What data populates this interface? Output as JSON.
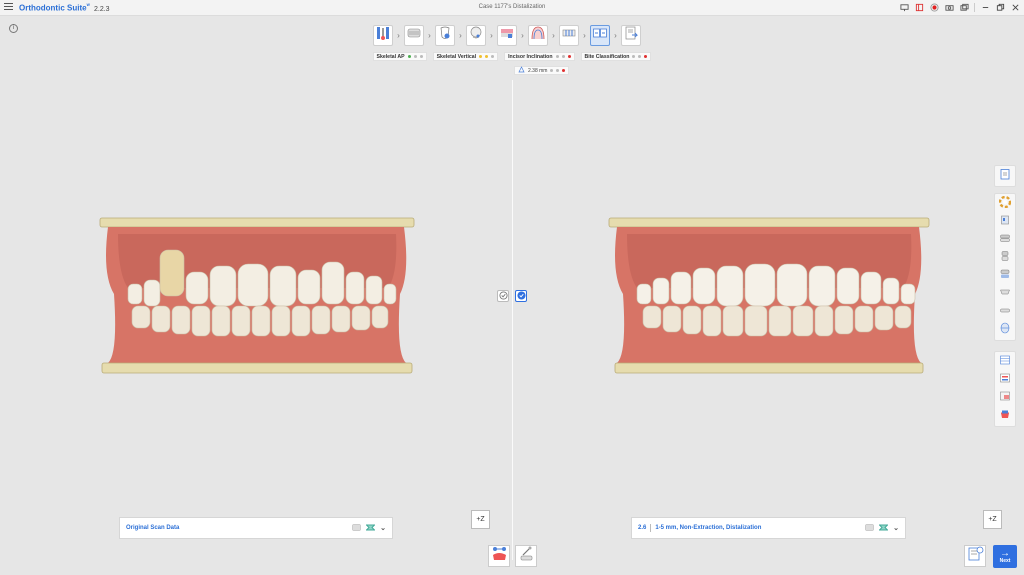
{
  "titlebar": {
    "app_name": "Orthodontic Suite",
    "app_sup": "ᵂ",
    "version": "2.2.3",
    "case_title": "Case 1177's Distalization"
  },
  "steps": [
    {
      "name": "step-model-setup",
      "icon": "tooth-tools-icon"
    },
    {
      "name": "step-trim",
      "icon": "arch-trim-icon"
    },
    {
      "name": "step-tooth-segment",
      "icon": "tooth-segment-icon"
    },
    {
      "name": "step-ceph",
      "icon": "ceph-head-icon"
    },
    {
      "name": "step-occlusion",
      "icon": "occlusion-icon"
    },
    {
      "name": "step-arch-form",
      "icon": "arch-form-icon"
    },
    {
      "name": "step-ipr",
      "icon": "ipr-icon"
    },
    {
      "name": "step-simulation",
      "icon": "compare-icon",
      "active": true
    },
    {
      "name": "step-report",
      "icon": "report-export-icon"
    }
  ],
  "analysis": [
    {
      "label": "Skeletal AP",
      "dots": [
        "#4caf50",
        "#bbbbbb",
        "#bbbbbb"
      ]
    },
    {
      "label": "Skeletal Vertical",
      "dots": [
        "#f0c030",
        "#f0c030",
        "#bbbbbb"
      ]
    },
    {
      "label": "Incisor Inclination",
      "dots": [
        "#bbbbbb",
        "#bbbbbb",
        "#e03030"
      ]
    },
    {
      "label": "Bite Classification",
      "dots": [
        "#bbbbbb",
        "#bbbbbb",
        "#e03030"
      ]
    }
  ],
  "measurement": {
    "value": "2.38 mm"
  },
  "panels": {
    "left_label": "Original Scan Data",
    "right_number": "2.6",
    "right_label": "1-5 mm, Non-Extraction, Distalization"
  },
  "buttons": {
    "z_label": "+Z",
    "next_label": "Next"
  },
  "colors": {
    "accent": "#2f6fe0",
    "gum": "#d97a6a",
    "tooth": "#f4efe4",
    "base": "#e8dcb0"
  }
}
